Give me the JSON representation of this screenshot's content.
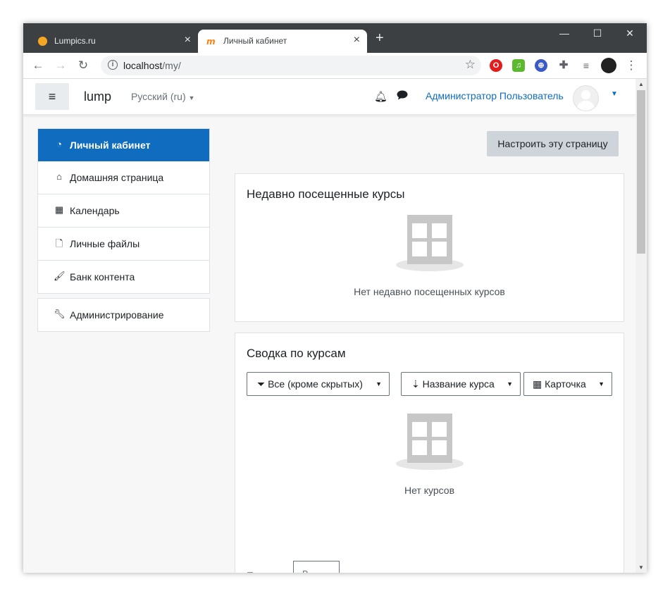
{
  "browser": {
    "tabs": [
      {
        "title": "Lumpics.ru",
        "active": false,
        "favicon": "orange-circle-icon"
      },
      {
        "title": "Личный кабинет",
        "active": true,
        "favicon": "moodle-icon"
      }
    ],
    "new_tab": "+",
    "url_host": "localhost",
    "url_path": "/my/",
    "window_controls": {
      "minimize": "—",
      "maximize": "☐",
      "close": "✕"
    }
  },
  "navbar": {
    "menu_icon": "≡",
    "brand": "lump",
    "language": "Русский (ru)",
    "username": "Администратор Пользователь"
  },
  "sidebar": {
    "items": [
      {
        "label": "Личный кабинет",
        "icon": "dashboard-icon",
        "active": true
      },
      {
        "label": "Домашняя страница",
        "icon": "home-icon"
      },
      {
        "label": "Календарь",
        "icon": "calendar-icon"
      },
      {
        "label": "Личные файлы",
        "icon": "file-icon"
      },
      {
        "label": "Банк контента",
        "icon": "paintbrush-icon"
      }
    ],
    "admin": {
      "label": "Администрирование",
      "icon": "wrench-icon"
    }
  },
  "main": {
    "customize_button": "Настроить эту страницу",
    "recent": {
      "title": "Недавно посещенные курсы",
      "empty_text": "Нет недавно посещенных курсов"
    },
    "overview": {
      "title": "Сводка по курсам",
      "filter": "Все (кроме скрытых)",
      "sort": "Название курса",
      "view": "Карточка",
      "empty_text": "Нет курсов",
      "pager_label": "П",
      "pager_value": "В"
    }
  },
  "colors": {
    "accent": "#0f6cbf",
    "chrome_dark": "#3c4043",
    "page_bg": "#f7f7f7"
  }
}
